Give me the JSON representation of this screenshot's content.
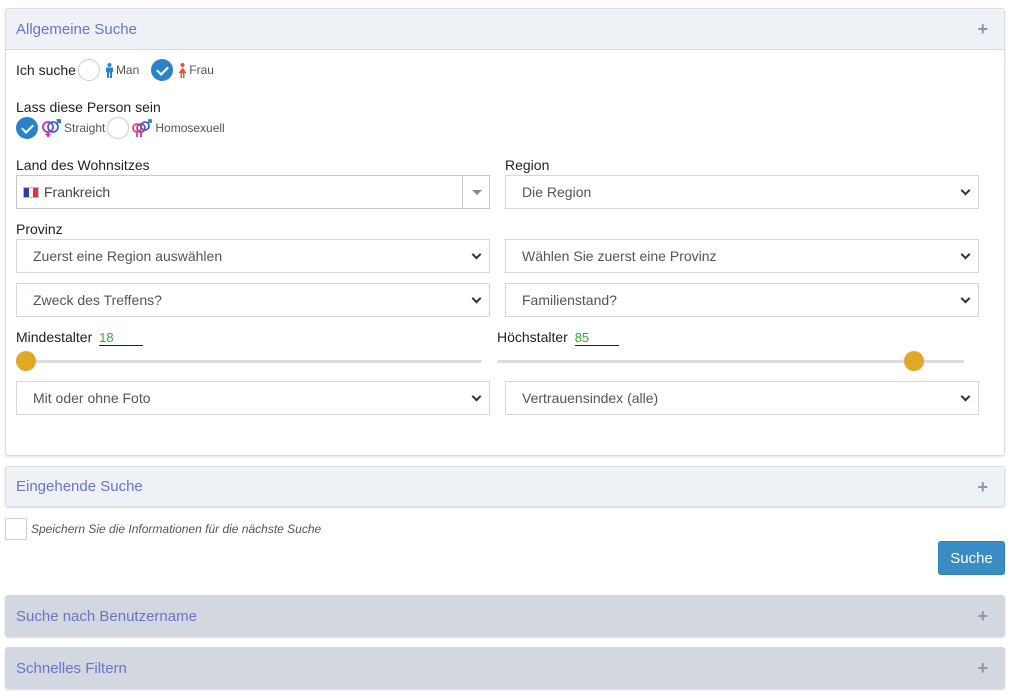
{
  "panels": {
    "general": {
      "title": "Allgemeine Suche",
      "toggle_icon": "plus-icon"
    },
    "detailed": {
      "title": "Eingehende Suche",
      "toggle_icon": "plus-icon"
    },
    "username": {
      "title": "Suche nach Benutzername",
      "toggle_icon": "plus-icon"
    },
    "quick": {
      "title": "Schnelles Filtern",
      "toggle_icon": "plus-icon"
    }
  },
  "looking_for": {
    "label": "Ich suche",
    "options": [
      {
        "label": "Man",
        "checked": false,
        "icon": "male-icon",
        "color": "#2a83c6"
      },
      {
        "label": "Frau",
        "checked": true,
        "icon": "female-icon",
        "color": "#e0533f"
      }
    ]
  },
  "orientation": {
    "label": "Lass diese Person sein",
    "options": [
      {
        "label": "Straight",
        "checked": true,
        "icon": "straight-icon"
      },
      {
        "label": "Homosexuell",
        "checked": false,
        "icon": "homosexual-icon"
      }
    ]
  },
  "country": {
    "label": "Land des Wohnsitzes",
    "value": "Frankreich",
    "flag": "france-flag"
  },
  "region": {
    "label": "Region",
    "value": "Die Region"
  },
  "province": {
    "label": "Provinz",
    "value": "Zuerst eine Region auswählen"
  },
  "city": {
    "value": "Wählen Sie zuerst eine Provinz"
  },
  "purpose": {
    "value": "Zweck des Treffens?"
  },
  "marital": {
    "value": "Familienstand?"
  },
  "min_age": {
    "label": "Mindestalter",
    "value": "18",
    "slider_fraction": 0.0
  },
  "max_age": {
    "label": "Höchstalter",
    "value": "85",
    "slider_fraction": 0.91
  },
  "photo": {
    "value": "Mit oder ohne Foto"
  },
  "trust": {
    "value": "Vertrauensindex (alle)"
  },
  "save_info": {
    "label": "Speichern Sie die Informationen für die nächste Suche",
    "checked": false
  },
  "search_button": {
    "label": "Suche"
  },
  "colors": {
    "accent": "#2a83c6",
    "button": "#3a8dc4",
    "slider_thumb": "#dfa827",
    "age_value": "#2ea82e",
    "panel_title": "#6a74c9"
  }
}
